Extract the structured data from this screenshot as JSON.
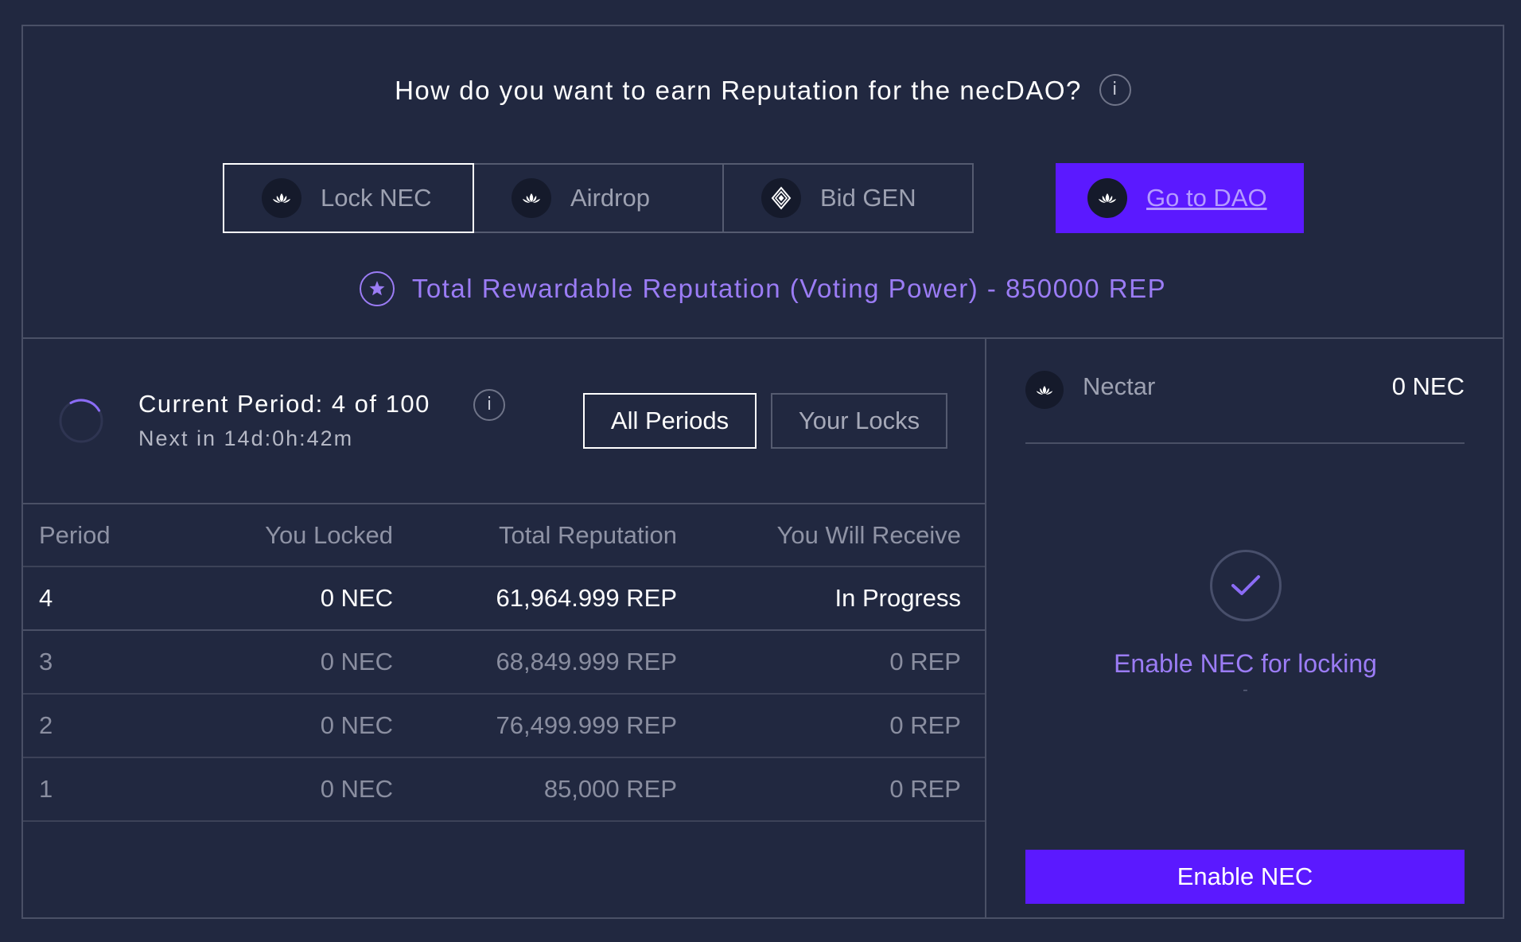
{
  "header": {
    "question": "How do you want to earn Reputation for the necDAO?",
    "info_glyph": "i"
  },
  "tabs": [
    {
      "label": "Lock NEC",
      "icon": "lotus-icon",
      "active": true
    },
    {
      "label": "Airdrop",
      "icon": "lotus-icon",
      "active": false
    },
    {
      "label": "Bid GEN",
      "icon": "gen-diamond-icon",
      "active": false
    }
  ],
  "go_to_dao": {
    "label": "Go to DAO",
    "icon": "lotus-icon"
  },
  "rewardable": {
    "text": "Total Rewardable Reputation (Voting Power) - 850000 REP",
    "icon": "star-icon"
  },
  "period": {
    "title": "Current Period: 4 of 100",
    "next": "Next in 14d:0h:42m",
    "progress_fraction": 0.04
  },
  "filters": {
    "all_periods": "All Periods",
    "your_locks": "Your Locks",
    "selected": "All Periods"
  },
  "table": {
    "headers": [
      "Period",
      "You Locked",
      "Total Reputation",
      "You Will Receive"
    ],
    "rows": [
      [
        "4",
        "0 NEC",
        "61,964.999 REP",
        "In Progress"
      ],
      [
        "3",
        "0 NEC",
        "68,849.999 REP",
        "0 REP"
      ],
      [
        "2",
        "0 NEC",
        "76,499.999 REP",
        "0 REP"
      ],
      [
        "1",
        "0 NEC",
        "85,000 REP",
        "0 REP"
      ]
    ]
  },
  "wallet": {
    "token_name": "Nectar",
    "balance": "0 NEC",
    "enable_text": "Enable NEC for locking",
    "enable_dash": "-",
    "enable_button": "Enable NEC"
  },
  "colors": {
    "background": "#212840",
    "accent": "#5b19ff",
    "purple_text": "#9b7cf5",
    "border": "#4a5066"
  }
}
